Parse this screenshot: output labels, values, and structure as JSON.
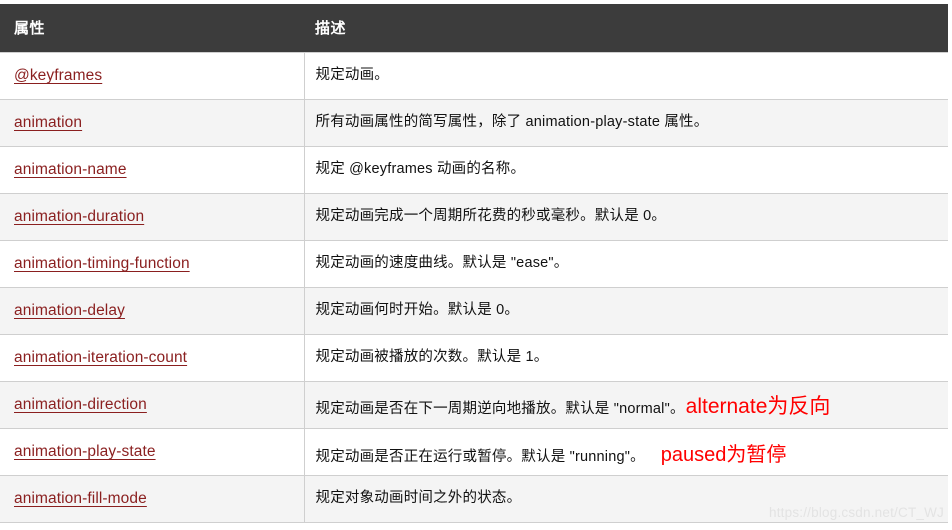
{
  "table": {
    "headers": {
      "property": "属性",
      "description": "描述"
    },
    "rows": [
      {
        "property": "@keyframes",
        "description": "规定动画。",
        "annotation": ""
      },
      {
        "property": "animation",
        "description": "所有动画属性的简写属性，除了 animation-play-state 属性。",
        "annotation": ""
      },
      {
        "property": "animation-name",
        "description": "规定 @keyframes 动画的名称。",
        "annotation": ""
      },
      {
        "property": "animation-duration",
        "description": "规定动画完成一个周期所花费的秒或毫秒。默认是 0。",
        "annotation": ""
      },
      {
        "property": "animation-timing-function",
        "description": "规定动画的速度曲线。默认是 \"ease\"。",
        "annotation": ""
      },
      {
        "property": "animation-delay",
        "description": "规定动画何时开始。默认是 0。",
        "annotation": ""
      },
      {
        "property": "animation-iteration-count",
        "description": "规定动画被播放的次数。默认是 1。",
        "annotation": ""
      },
      {
        "property": "animation-direction",
        "description": "规定动画是否在下一周期逆向地播放。默认是 \"normal\"。",
        "annotation": "alternate为反向"
      },
      {
        "property": "animation-play-state",
        "description": "规定动画是否正在运行或暂停。默认是 \"running\"。",
        "annotation": "paused为暂停"
      },
      {
        "property": "animation-fill-mode",
        "description": "规定对象动画时间之外的状态。",
        "annotation": ""
      }
    ]
  },
  "watermark": "https://blog.csdn.net/CT_WJ",
  "colors": {
    "header_bg": "#3c3c3c",
    "link": "#8a1f1f",
    "annotation": "#ff0000",
    "row_alt_bg": "#f4f4f4",
    "border": "#cfcfcf"
  }
}
